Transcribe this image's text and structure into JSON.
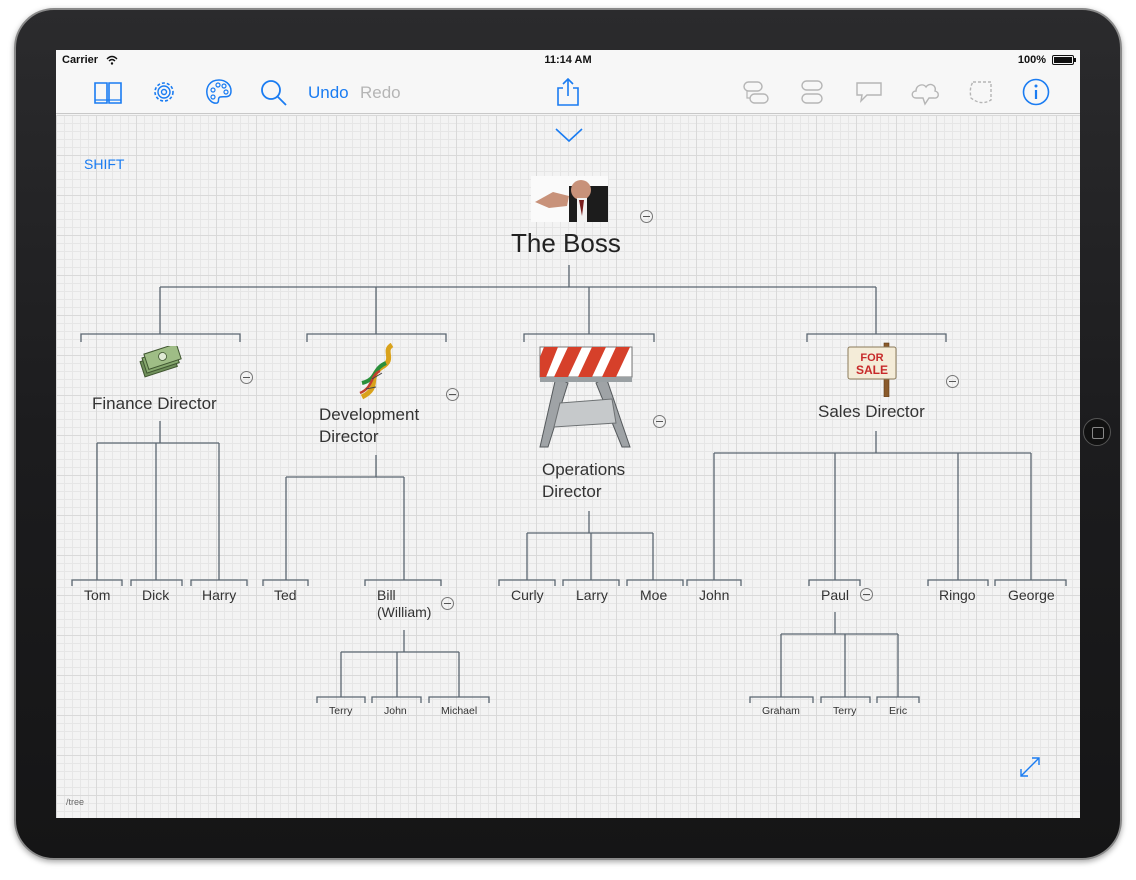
{
  "status_bar": {
    "carrier": "Carrier",
    "time": "11:14 AM",
    "battery": "100%"
  },
  "toolbar": {
    "undo_label": "Undo",
    "redo_label": "Redo"
  },
  "canvas": {
    "shift_label": "SHIFT",
    "path_label": "/tree"
  },
  "tree": {
    "root": {
      "label": "The Boss"
    },
    "finance": {
      "label": "Finance Director",
      "children": [
        "Tom",
        "Dick",
        "Harry"
      ]
    },
    "development": {
      "label_line1": "Development",
      "label_line2": "Director",
      "children": [
        "Ted"
      ],
      "bill_line1": "Bill",
      "bill_line2": "(William)",
      "bill_children": [
        "Terry",
        "John",
        "Michael"
      ]
    },
    "operations": {
      "label_line1": "Operations",
      "label_line2": "Director",
      "children": [
        "Curly",
        "Larry",
        "Moe"
      ]
    },
    "sales": {
      "label": "Sales Director",
      "children": [
        "John",
        "Paul",
        "Ringo",
        "George"
      ],
      "paul_children": [
        "Graham",
        "Terry",
        "Eric"
      ]
    }
  },
  "colors": {
    "accent": "#1a7cf2",
    "line": "#5a6670",
    "disabled": "#b5b5b5"
  },
  "icons": [
    "book-icon",
    "gear-icon",
    "palette-icon",
    "search-icon",
    "share-icon",
    "chevron-down-icon",
    "add-sibling-icon",
    "add-child-icon",
    "callout-icon",
    "cloud-icon",
    "boundary-icon",
    "info-icon",
    "expand-icon"
  ]
}
